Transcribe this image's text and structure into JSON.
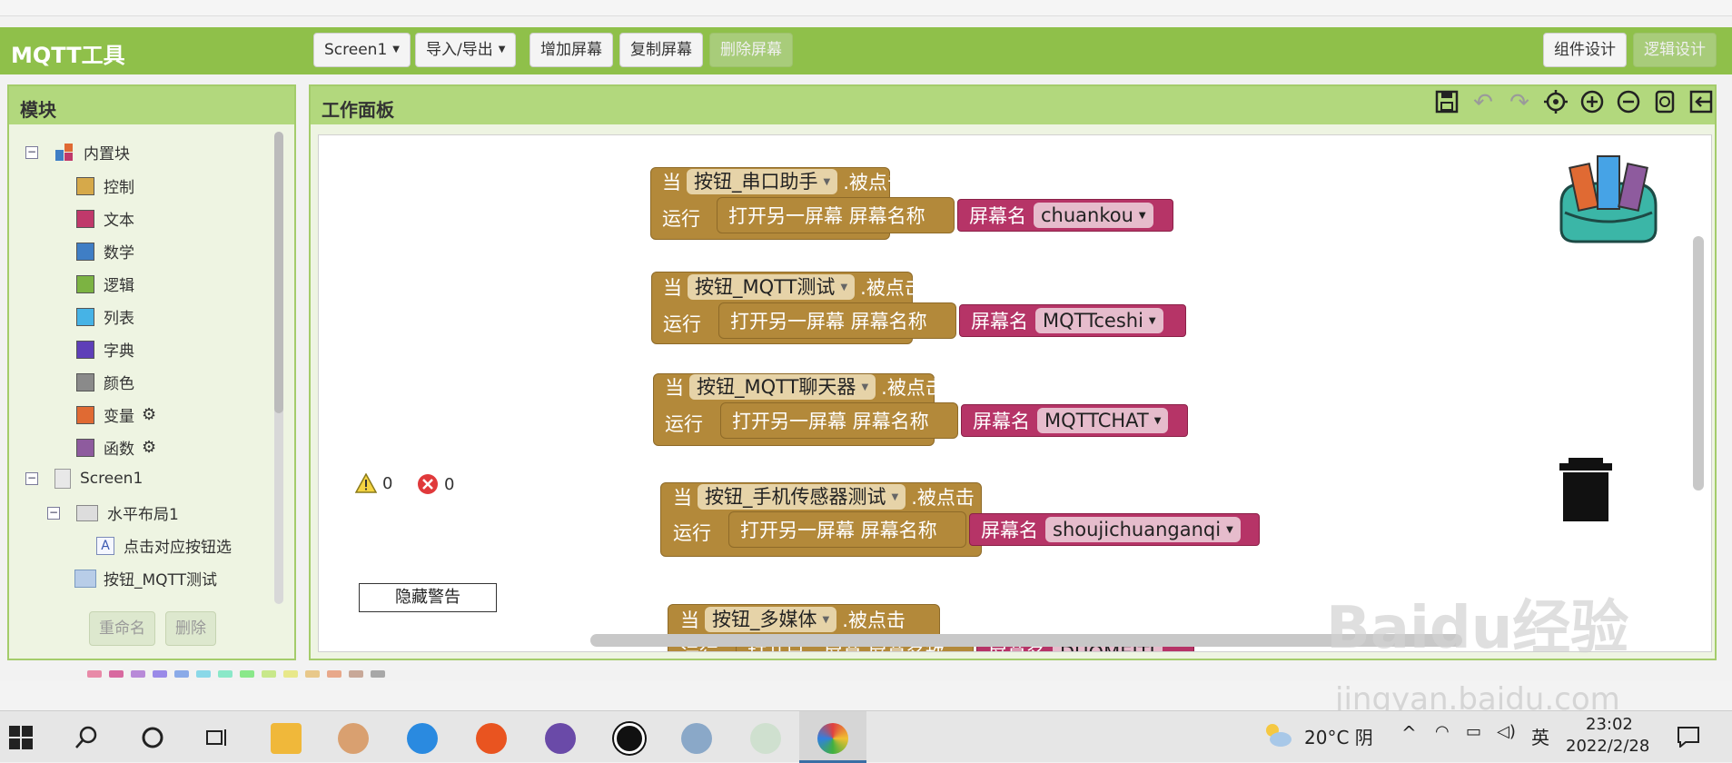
{
  "app": {
    "title": "MQTT工具",
    "toolbar": {
      "screen_select": "Screen1",
      "import_export": "导入/导出",
      "add_screen": "增加屏幕",
      "copy_screen": "复制屏幕",
      "delete_screen": "删除屏幕",
      "designer": "组件设计",
      "blocks": "逻辑设计"
    }
  },
  "blocks_panel": {
    "title": "模块",
    "builtin": "内置块",
    "categories": [
      {
        "label": "控制",
        "color": "#d6a94a"
      },
      {
        "label": "文本",
        "color": "#c0396b"
      },
      {
        "label": "数学",
        "color": "#3f7ec5"
      },
      {
        "label": "逻辑",
        "color": "#7cb342"
      },
      {
        "label": "列表",
        "color": "#46b3e6"
      },
      {
        "label": "字典",
        "color": "#5e3fb8"
      },
      {
        "label": "颜色",
        "color": "#8a8a8a"
      },
      {
        "label": "变量",
        "color": "#e06a33"
      },
      {
        "label": "函数",
        "color": "#8e5b9e"
      }
    ],
    "screen": "Screen1",
    "layout": "水平布局1",
    "label_item": "点击对应按钮选",
    "button_item": "按钮_MQTT测试",
    "rename": "重命名",
    "delete": "删除"
  },
  "workspace": {
    "title": "工作面板",
    "warnings": "0",
    "errors": "0",
    "hide_warnings": "隐藏警告",
    "when": "当",
    "clicked": ".被点击",
    "do": "运行",
    "open_screen": "打开另一屏幕  屏幕名称",
    "screen_name_label": "屏幕名",
    "events": [
      {
        "component": "按钮_串口助手",
        "screen": "chuankou"
      },
      {
        "component": "按钮_MQTT测试",
        "screen": "MQTTceshi"
      },
      {
        "component": "按钮_MQTT聊天器",
        "screen": "MQTTCHAT"
      },
      {
        "component": "按钮_手机传感器测试",
        "screen": "shoujichuanganqi"
      },
      {
        "component": "按钮_多媒体",
        "screen": "DUOMEITI"
      }
    ]
  },
  "taskbar": {
    "weather": "20°C 阴",
    "ime": "英",
    "time": "23:02",
    "date": "2022/2/28"
  },
  "watermark": {
    "text": "Baidu经验",
    "url": "jingyan.baidu.com"
  }
}
